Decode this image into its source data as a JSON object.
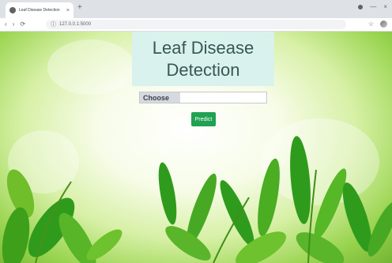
{
  "browser": {
    "tab": {
      "title": "Leaf Disease Detection"
    },
    "url": "127.0.0.1:5000",
    "controls": {
      "minimize": "—",
      "close": "×"
    }
  },
  "page": {
    "title_line1": "Leaf Disease",
    "title_line2": "Detection",
    "file_input": {
      "button_label": "Choose"
    },
    "predict_button": "Predict"
  },
  "colors": {
    "title_bg": "#d9f2ef",
    "predict_button": "#21a152",
    "leaf_green": "#2f9b1d"
  }
}
